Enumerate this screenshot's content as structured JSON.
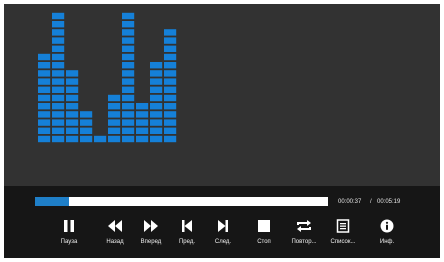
{
  "visualizer": {
    "bar_color": "#1580d8",
    "levels": [
      11,
      16,
      9,
      4,
      1,
      6,
      16,
      5,
      10,
      14
    ]
  },
  "player": {
    "elapsed": "00:00:37",
    "separator": "/",
    "total": "00:05:19",
    "progress_fraction": 0.116,
    "accent_color": "#1e7fc9"
  },
  "controls": [
    {
      "id": "pause",
      "label": "Пауза",
      "icon": "pause-icon",
      "active": true
    },
    {
      "id": "rewind",
      "label": "Назад",
      "icon": "rewind-icon",
      "active": false
    },
    {
      "id": "fast-forward",
      "label": "Вперед",
      "icon": "fast-forward-icon",
      "active": false
    },
    {
      "id": "previous",
      "label": "Пред.",
      "icon": "skip-previous-icon",
      "active": false
    },
    {
      "id": "next",
      "label": "След.",
      "icon": "skip-next-icon",
      "active": false
    },
    {
      "id": "stop",
      "label": "Стоп",
      "icon": "stop-icon",
      "active": false
    },
    {
      "id": "repeat",
      "label": "Повтор...",
      "icon": "repeat-icon",
      "active": false
    },
    {
      "id": "playlist",
      "label": "Список...",
      "icon": "list-icon",
      "active": false
    },
    {
      "id": "info",
      "label": "Инф.",
      "icon": "info-icon",
      "active": false
    }
  ]
}
